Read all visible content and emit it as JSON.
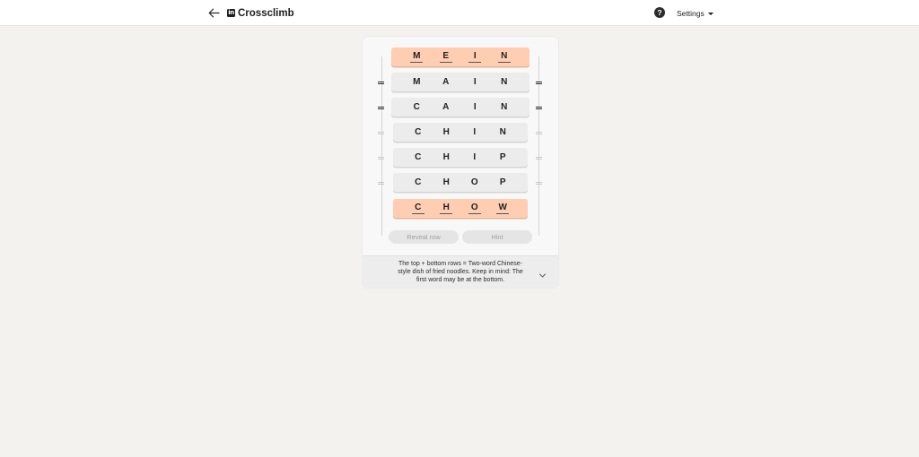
{
  "header": {
    "title": "Crossclimb",
    "logo_text": "in",
    "help_symbol": "?",
    "settings_label": "Settings"
  },
  "puzzle": {
    "rows": [
      {
        "letters": [
          "M",
          "E",
          "I",
          "N"
        ],
        "locked": true
      },
      {
        "letters": [
          "M",
          "A",
          "I",
          "N"
        ],
        "locked": false
      },
      {
        "letters": [
          "C",
          "A",
          "I",
          "N"
        ],
        "locked": false
      },
      {
        "letters": [
          "C",
          "H",
          "I",
          "N"
        ],
        "locked": false
      },
      {
        "letters": [
          "C",
          "H",
          "I",
          "P"
        ],
        "locked": false
      },
      {
        "letters": [
          "C",
          "H",
          "O",
          "P"
        ],
        "locked": false
      },
      {
        "letters": [
          "C",
          "H",
          "O",
          "W"
        ],
        "locked": true
      }
    ]
  },
  "actions": {
    "reveal_label": "Reveal row",
    "hint_label": "Hint"
  },
  "clue": {
    "text": "The top + bottom rows = Two-word Chinese-style dish of fried noodles. Keep in mind: The first word may be at the bottom."
  },
  "colors": {
    "accent_row": "#ffcdb2",
    "row": "#ececec",
    "background": "#f4f2ee"
  }
}
